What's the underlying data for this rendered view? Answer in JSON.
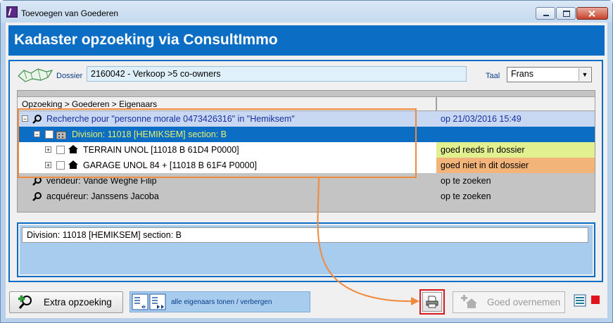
{
  "window": {
    "title": "Toevoegen van Goederen"
  },
  "header": {
    "title": "Kadaster opzoeking via ConsultImmo"
  },
  "dossier": {
    "label": "Dossier",
    "value": "2160042 - Verkoop >5 co-owners"
  },
  "language": {
    "label": "Taal",
    "selected": "Frans"
  },
  "tree": {
    "header": "Opzoeking > Goederen > Eigenaars",
    "rows": [
      {
        "text": "Recherche pour \"personne morale 0473426316\" in \"Hemiksem\"",
        "status": "op 21/03/2016 15:49"
      },
      {
        "text": "Division: 11018 [HEMIKSEM]  section: B",
        "status": ""
      },
      {
        "text": "TERRAIN   UNOL     [11018 B 61D4 P0000]",
        "status": "goed reeds in dossier"
      },
      {
        "text": "GARAGE   UNOL 84 +     [11018 B 61F4 P0000]",
        "status": "goed niet in dit dossier"
      },
      {
        "text": "vendeur: Vande Weghe Filip",
        "status": "op te zoeken"
      },
      {
        "text": "acquéreur: Janssens Jacoba",
        "status": "op te zoeken"
      }
    ]
  },
  "detail": {
    "value": "Division: 11018 [HEMIKSEM]  section: B"
  },
  "buttons": {
    "extra": "Extra opzoeking",
    "toggle": "alle eigenaars tonen / verbergen",
    "goed": "Goed overnemen"
  },
  "colors": {
    "header_blue": "#0b6ec4",
    "row_selected": "#0b6ec4",
    "row_selected_text": "#e8f26a",
    "status_in_dossier": "#e2f090",
    "status_not_in_dossier": "#f3b47a",
    "annotation_orange": "#f08a3c",
    "highlight_red": "#d81a1a"
  }
}
